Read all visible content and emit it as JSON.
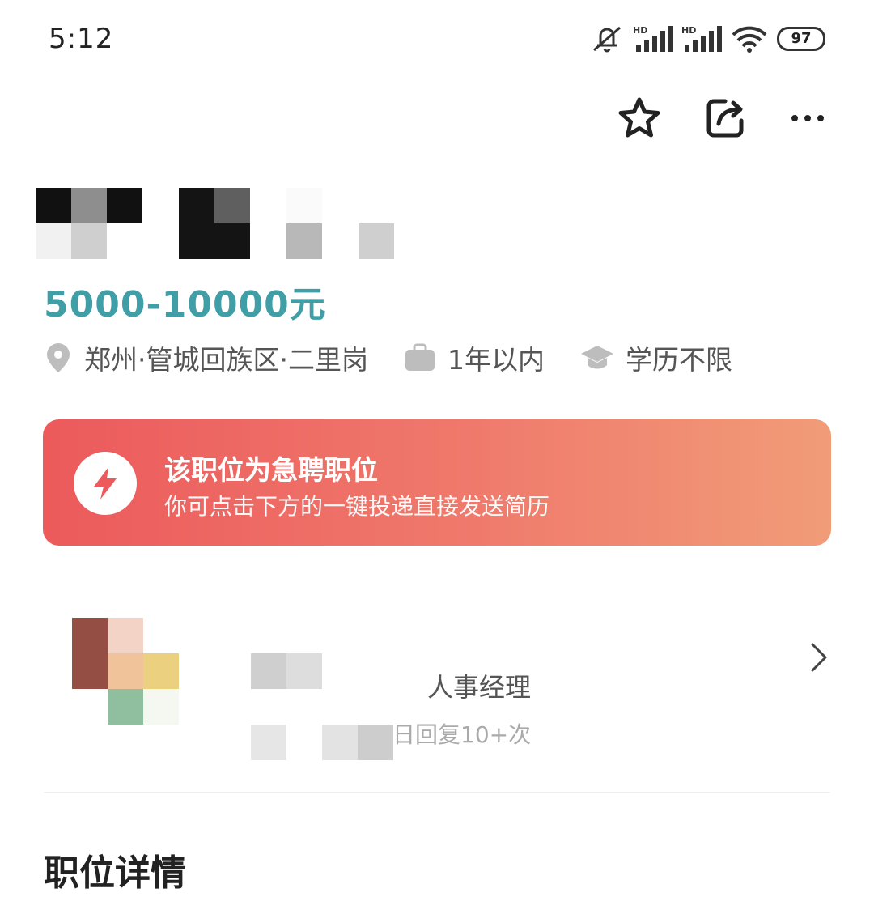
{
  "status_bar": {
    "time": "5:12",
    "battery": "97",
    "icons": [
      "mute-icon",
      "hd-signal-icon",
      "hd-signal-icon",
      "wifi-icon",
      "battery-icon"
    ]
  },
  "toolbar": {
    "icons": [
      "star-icon",
      "share-icon",
      "more-icon"
    ]
  },
  "job": {
    "salary": "5000-10000元",
    "location": "郑州·管城回族区·二里岗",
    "experience": "1年以内",
    "education": "学历不限"
  },
  "banner": {
    "title": "该职位为急聘职位",
    "subtitle": "你可点击下方的一键投递直接发送简历"
  },
  "recruiter": {
    "role": "人事经理",
    "reply": "日回复10+次"
  },
  "section": {
    "title": "职位详情"
  },
  "colors": {
    "salary": "#3f9ea6",
    "banner_start": "#ec5a5c",
    "banner_end": "#f19c78"
  }
}
